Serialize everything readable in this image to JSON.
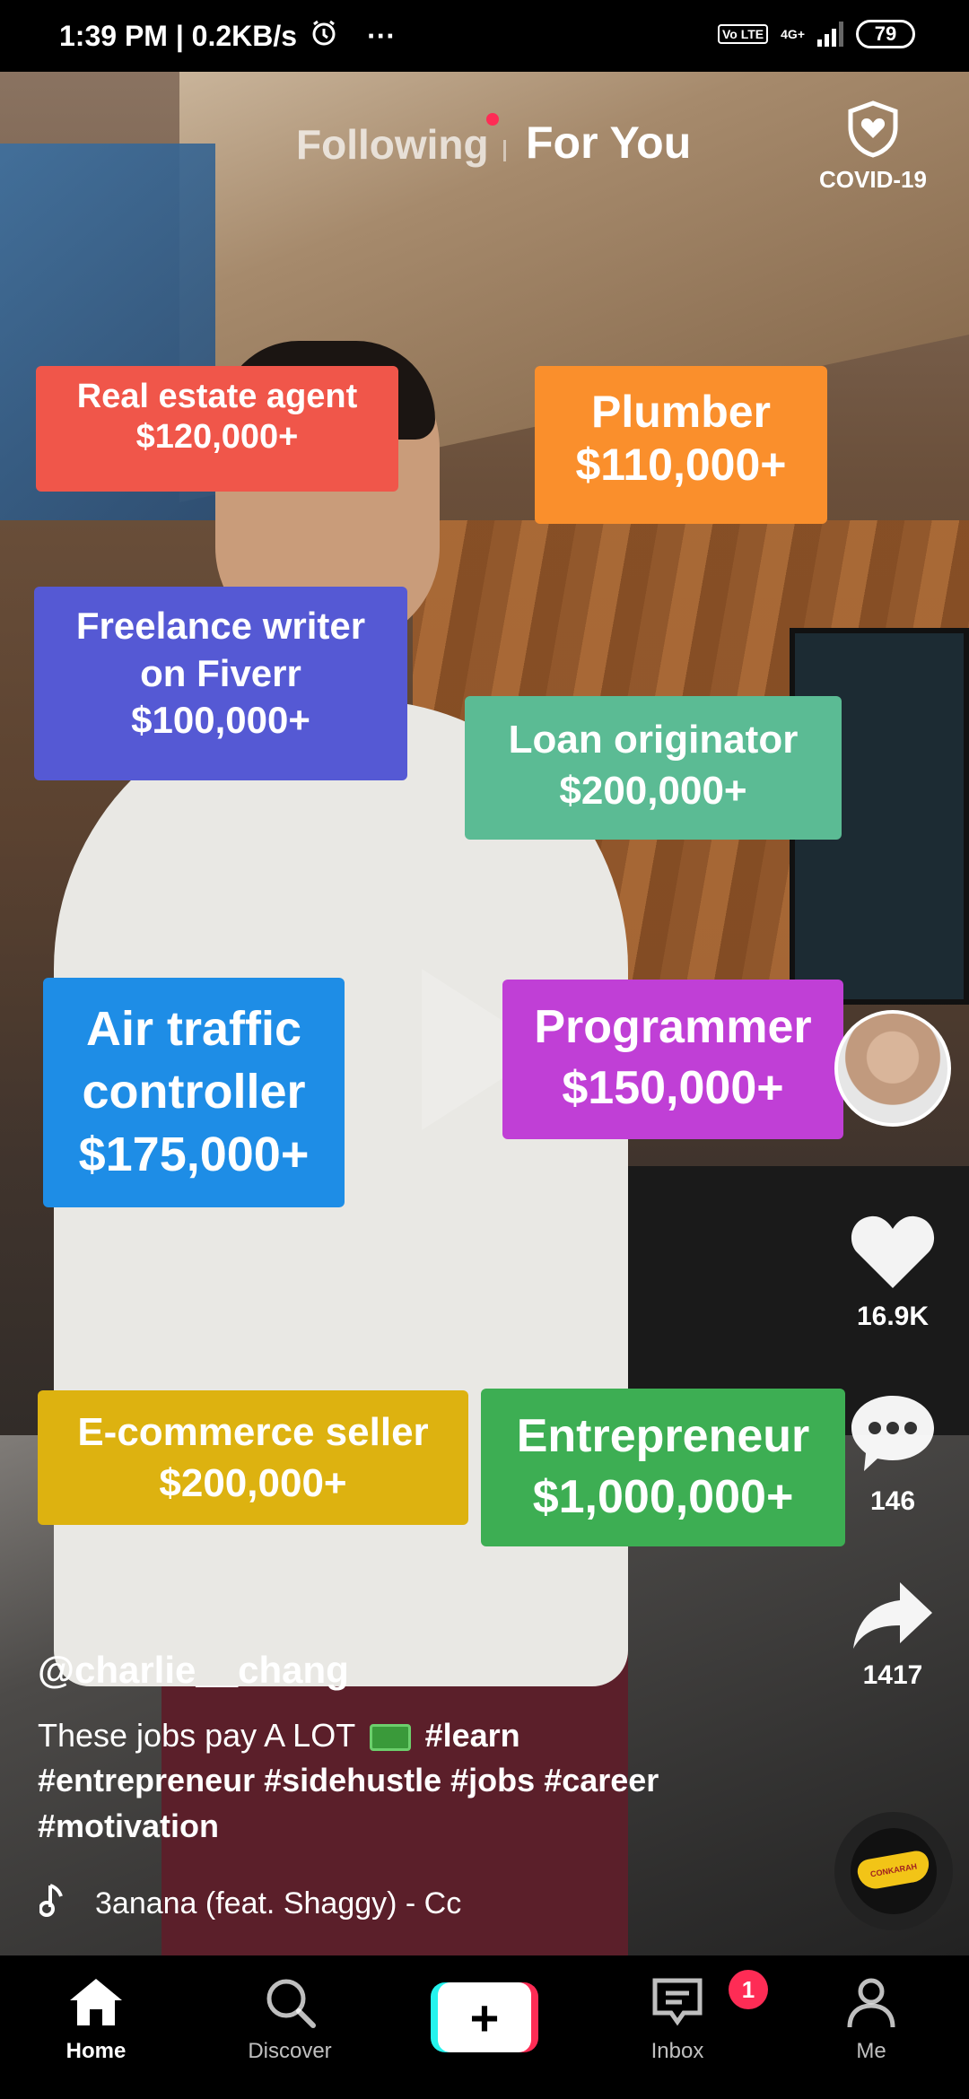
{
  "status_bar": {
    "time": "1:39 PM | 0.2KB/s",
    "more": "···",
    "volte": "Vo LTE",
    "network": "4G+",
    "battery": "79"
  },
  "top_nav": {
    "following_label": "Following",
    "for_you_label": "For You",
    "covid_label": "COVID-19"
  },
  "jobs": [
    {
      "title": "Real estate agent",
      "salary": "$120,000+"
    },
    {
      "title": "Plumber",
      "salary": "$110,000+"
    },
    {
      "title": "Freelance writer on Fiverr",
      "line1": "Freelance writer",
      "line2": "on Fiverr",
      "salary": "$100,000+"
    },
    {
      "title": "Loan originator",
      "salary": "$200,000+"
    },
    {
      "title": "Air traffic controller",
      "line1": "Air traffic",
      "line2": "controller",
      "salary": "$175,000+"
    },
    {
      "title": "Programmer",
      "salary": "$150,000+"
    },
    {
      "title": "E-commerce seller",
      "salary": "$200,000+"
    },
    {
      "title": "Entrepreneur",
      "salary": "$1,000,000+"
    }
  ],
  "rail": {
    "likes": "16.9K",
    "comments": "146",
    "shares": "1417"
  },
  "caption": {
    "username": "@charlie__chang",
    "text_before": "These jobs pay A LOT",
    "tags_line1": "#learn",
    "tags_line2": "#entrepreneur #sidehustle #jobs #career",
    "tags_line3": "#motivation"
  },
  "music": {
    "track": "3anana (feat. Shaggy) - Cc"
  },
  "disc": {
    "label": "CONKARAH"
  },
  "bottom_nav": {
    "home": "Home",
    "discover": "Discover",
    "create": "+",
    "inbox": "Inbox",
    "inbox_badge": "1",
    "me": "Me"
  },
  "colors": {
    "accent_red": "#fe2c55",
    "accent_cyan": "#25f4ee",
    "real_estate": "#f0564a",
    "plumber": "#fa8f2c",
    "freelance": "#5559d4",
    "loan": "#5bbb94",
    "air_traffic": "#1e8de6",
    "programmer": "#c03fd6",
    "ecommerce": "#ddb210",
    "entrepreneur": "#3dae53"
  }
}
